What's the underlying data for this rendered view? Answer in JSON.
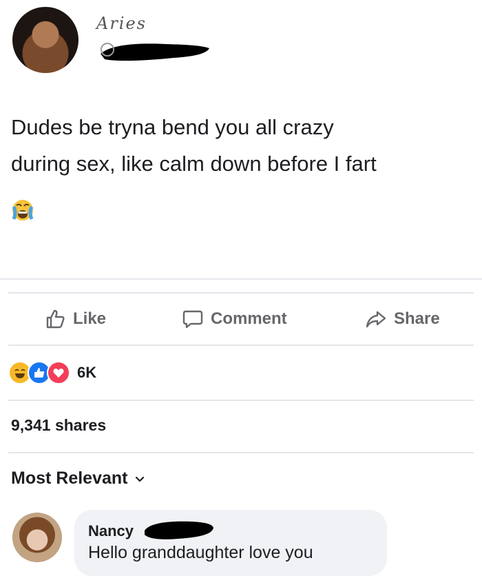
{
  "post": {
    "author": "Aries",
    "text_line1": "Dudes be tryna bend you all crazy",
    "text_line2": "during sex, like calm down before I fart"
  },
  "actions": {
    "like": "Like",
    "comment": "Comment",
    "share": "Share"
  },
  "reactions": {
    "icons": [
      "laugh-react-icon",
      "like-react-icon",
      "love-react-icon"
    ],
    "count": "6K"
  },
  "shares": "9,341 shares",
  "sort": {
    "label": "Most Relevant"
  },
  "comment": {
    "name": "Nancy",
    "text": "Hello granddaughter love you"
  },
  "colors": {
    "text": "#1c1e21",
    "muted": "#65676b",
    "like_blue": "#1877f2",
    "love_red": "#f33e58",
    "haha_yellow": "#f7b928",
    "bubble": "#f0f2f5"
  }
}
